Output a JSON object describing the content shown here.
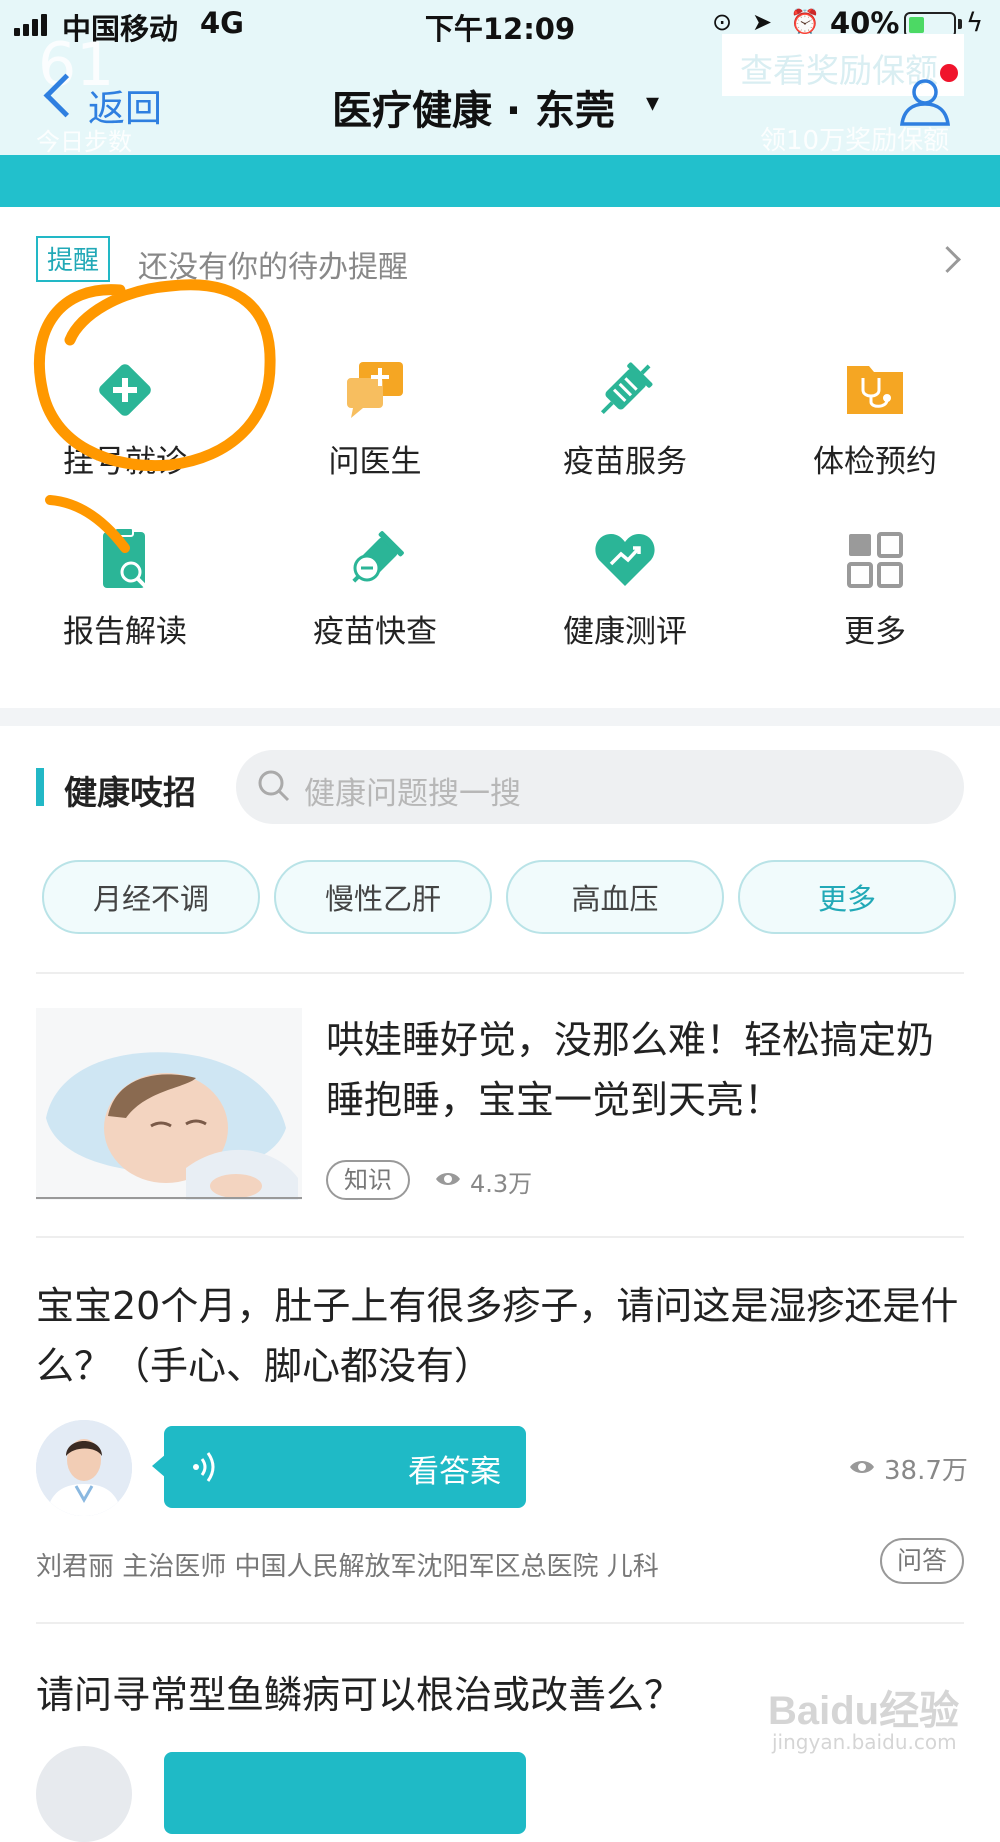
{
  "status_bar": {
    "carrier": "中国移动",
    "network": "4G",
    "time": "下午12:09",
    "battery_pct": "40%",
    "battery_level": 0.4
  },
  "header": {
    "steps_count": "61",
    "steps_label": "今日步数",
    "reward_label": "查看奖励保额",
    "reward_sub": "领10万奖励保额",
    "back_label": "返回",
    "title": "医疗健康 · 东莞",
    "caret": "▾"
  },
  "reminder": {
    "tag": "提醒",
    "text": "还没有你的待办提醒"
  },
  "services": [
    {
      "label": "挂号就诊",
      "icon": "plus-diamond-icon"
    },
    {
      "label": "问医生",
      "icon": "chat-plus-icon"
    },
    {
      "label": "疫苗服务",
      "icon": "syringe-icon"
    },
    {
      "label": "体检预约",
      "icon": "stethoscope-folder-icon"
    },
    {
      "label": "报告解读",
      "icon": "report-search-icon"
    },
    {
      "label": "疫苗快查",
      "icon": "vaccine-check-icon"
    },
    {
      "label": "健康测评",
      "icon": "heart-trend-icon"
    },
    {
      "label": "更多",
      "icon": "grid-icon"
    }
  ],
  "tips": {
    "title": "健康吱招",
    "search_placeholder": "健康问题搜一搜",
    "chips": [
      "月经不调",
      "慢性乙肝",
      "高血压",
      "更多"
    ]
  },
  "articles": [
    {
      "title": "哄娃睡好觉，没那么难！轻松搞定奶睡抱睡，宝宝一觉到天亮！",
      "tag": "知识",
      "views": "4.3万"
    },
    {
      "title": "宝宝20个月，肚子上有很多疹子，请问这是湿疹还是什么？（手心、脚心都没有）",
      "answer_label": "看答案",
      "views": "38.7万",
      "doctor": "刘君丽  主治医师  中国人民解放军沈阳军区总医院  儿科",
      "tag": "问答"
    },
    {
      "title": "请问寻常型鱼鳞病可以根治或改善么？"
    }
  ],
  "watermark": {
    "logo": "Baidu经验",
    "site": "jingyan.baidu.com"
  },
  "colors": {
    "teal": "#22c0cc",
    "green_icon": "#2bb597",
    "orange_icon": "#f5a623",
    "blue_link": "#2f7fe0",
    "annotation": "#ff9800"
  }
}
